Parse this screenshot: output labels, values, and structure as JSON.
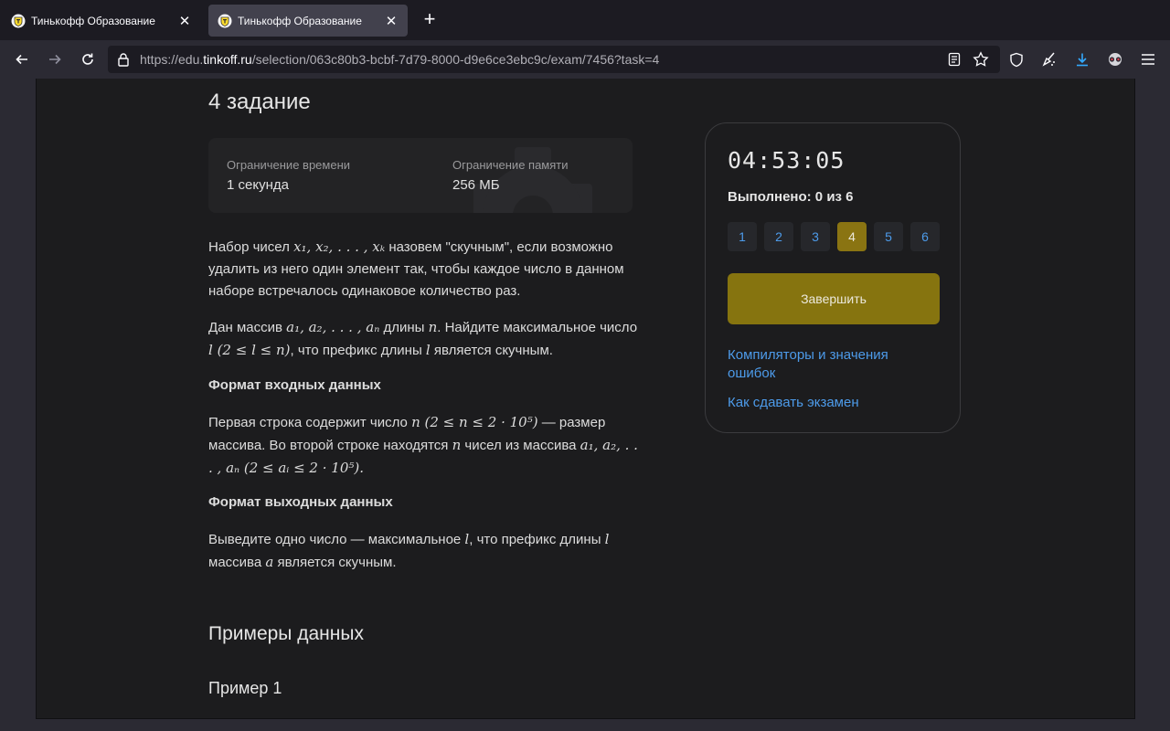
{
  "browser": {
    "tabs": [
      {
        "title": "Тинькофф Образование",
        "active": false
      },
      {
        "title": "Тинькофф Образование",
        "active": true
      }
    ],
    "close_glyph": "✕",
    "newtab_glyph": "+",
    "url": {
      "prefix": "https://edu.",
      "domain": "tinkoff.ru",
      "path": "/selection/063c80b3-bcbf-7d79-8000-d9e6ce3ebc9c/exam/7456?task=4"
    }
  },
  "task": {
    "title": "4 задание",
    "time_limit_label": "Ограничение времени",
    "time_limit_value": "1 секунда",
    "memory_limit_label": "Ограничение памяти",
    "memory_limit_value": "256 МБ",
    "p1": {
      "a": "Набор чисел ",
      "m1": "x₁, x₂, . . . , xₖ",
      "b": " назовем \"скучным\", если возможно удалить из него один элемент так, чтобы каждое число в данном наборе встречалось одинаковое количество раз."
    },
    "p2": {
      "a": "Дан массив ",
      "m1": "a₁, a₂, . . . , aₙ",
      "b": " длины ",
      "m2": "n",
      "c": ". Найдите максимальное число ",
      "m3": "l (2 ≤ l ≤ n)",
      "d": ", что префикс длины ",
      "m4": "l",
      "e": " является скучным."
    },
    "input_heading": "Формат входных данных",
    "p3": {
      "a": "Первая строка содержит число ",
      "m1": "n (2 ≤ n ≤ 2 · 10⁵)",
      "b": " — размер массива. Во второй строке находятся ",
      "m2": "n",
      "c": " чисел из массива ",
      "m3": "a₁, a₂, . . . , aₙ (2 ≤ aᵢ ≤ 2 · 10⁵).",
      "d": ""
    },
    "output_heading": "Формат выходных данных",
    "p4": {
      "a": "Выведите одно число — максимальное ",
      "m1": "l",
      "b": ", что префикс длины ",
      "m2": "l",
      "c": " массива ",
      "m3": "a",
      "d": " является скучным."
    },
    "examples_heading": "Примеры данных",
    "example1_heading": "Пример 1"
  },
  "sidebar": {
    "timer": "04:53:05",
    "progress_text": "Выполнено: 0 из 6",
    "progress_completed": 0,
    "progress_total": 6,
    "task_numbers": [
      "1",
      "2",
      "3",
      "4",
      "5",
      "6"
    ],
    "current_task": "4",
    "finish_label": "Завершить",
    "link_compilers": "Компиляторы и значения ошибок",
    "link_howto": "Как сдавать экзамен"
  },
  "colors": {
    "accent_link": "#4d9bea",
    "finish_button": "#86740f",
    "page_bg": "#1c1c1e"
  }
}
